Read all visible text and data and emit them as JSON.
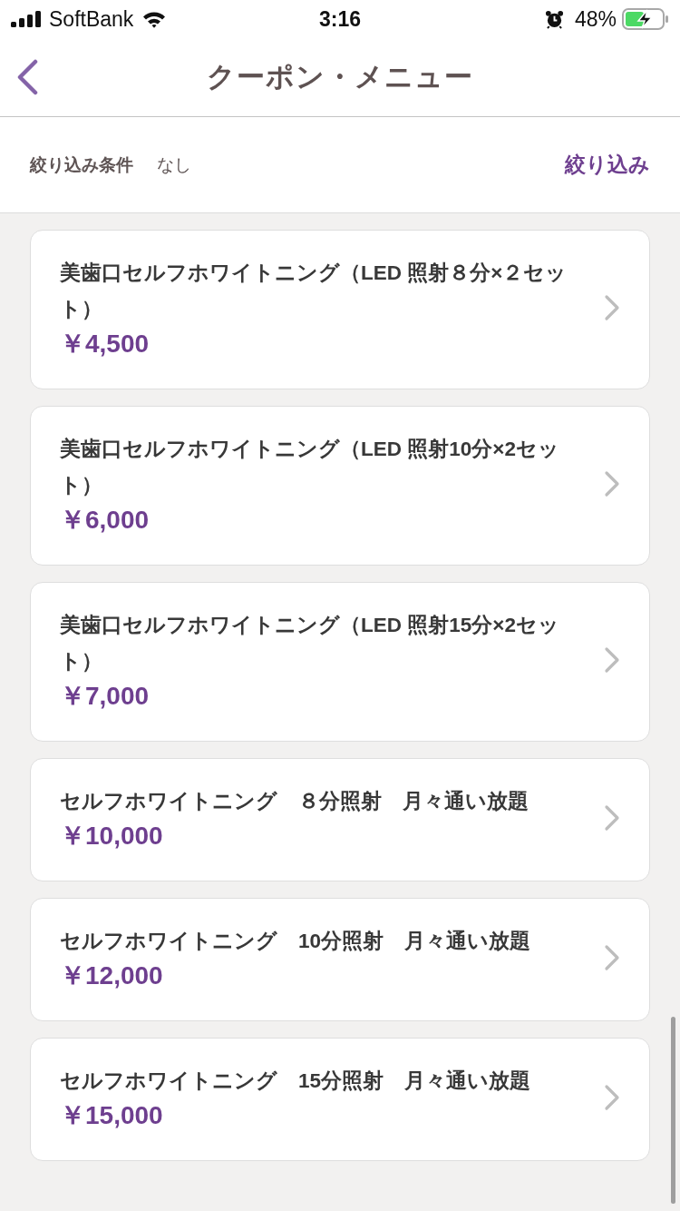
{
  "status_bar": {
    "carrier": "SoftBank",
    "time": "3:16",
    "battery": "48%"
  },
  "nav": {
    "title": "クーポン・メニュー"
  },
  "filter": {
    "label": "絞り込み条件",
    "value": "なし",
    "button": "絞り込み"
  },
  "coupons": [
    {
      "title": "美歯口セルフホワイトニング（LED 照射８分×２セット）",
      "price": "￥4,500"
    },
    {
      "title": "美歯口セルフホワイトニング（LED 照射10分×2セット）",
      "price": "￥6,000"
    },
    {
      "title": "美歯口セルフホワイトニング（LED 照射15分×2セット）",
      "price": "￥7,000"
    },
    {
      "title": "セルフホワイトニング　８分照射　月々通い放題",
      "price": "￥10,000"
    },
    {
      "title": "セルフホワイトニング　10分照射　月々通い放題",
      "price": "￥12,000"
    },
    {
      "title": "セルフホワイトニング　15分照射　月々通い放題",
      "price": "￥15,000"
    }
  ]
}
